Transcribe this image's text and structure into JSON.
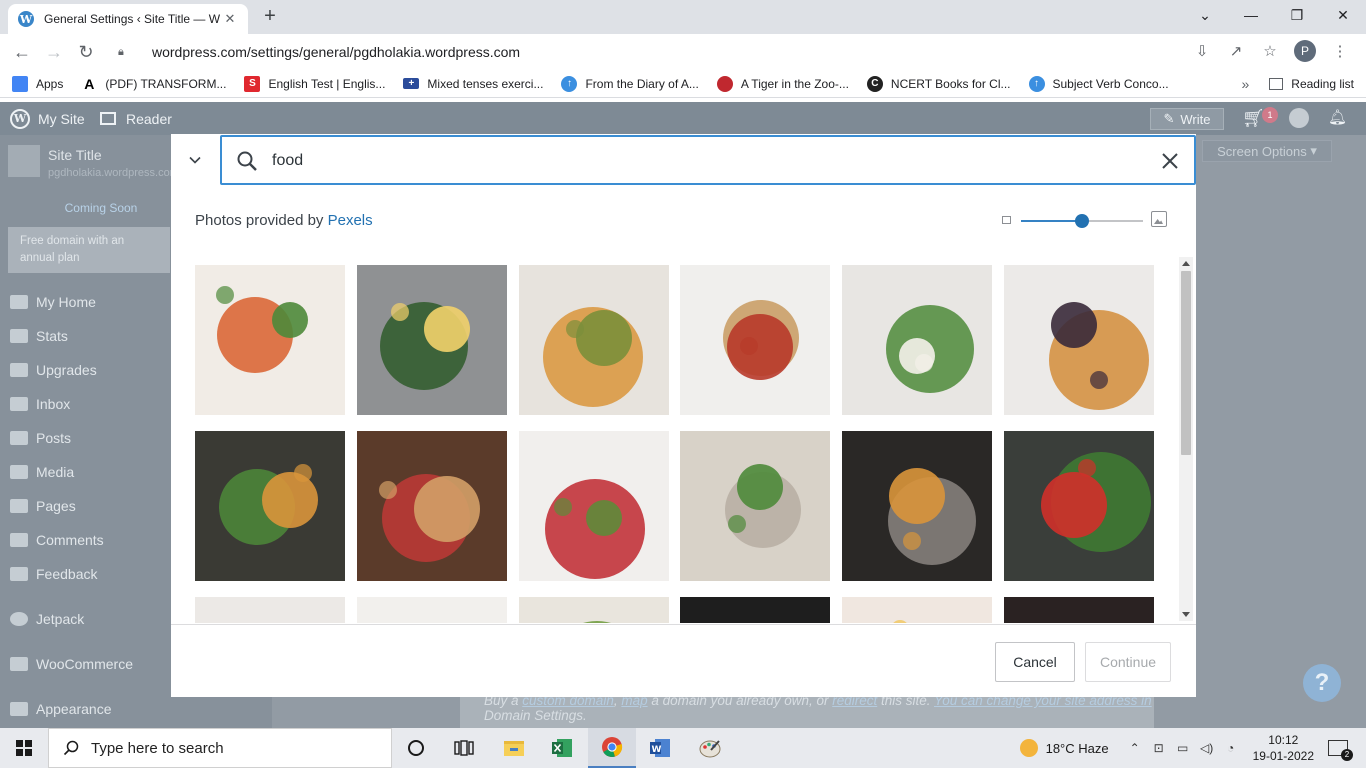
{
  "browser": {
    "tab_title": "General Settings ‹ Site Title — W",
    "url": "wordpress.com/settings/general/pgdholakia.wordpress.com",
    "profile_initial": "P",
    "bookmarks": [
      {
        "label": "Apps",
        "icon": "apps-grid-icon",
        "color": "#4285f4"
      },
      {
        "label": "(PDF) TRANSFORM...",
        "icon": "academia-icon",
        "color": "#000000"
      },
      {
        "label": "English Test | Englis...",
        "icon": "s-logo-icon",
        "color": "#e0282f"
      },
      {
        "label": "Mixed tenses exerci...",
        "icon": "uk-flag-icon",
        "color": "#2b4c9b"
      },
      {
        "label": "From the Diary of A...",
        "icon": "upload-arrow-icon",
        "color": "#3b8fe0"
      },
      {
        "label": "A Tiger in the Zoo-...",
        "icon": "quiz-badge-icon",
        "color": "#c0282f"
      },
      {
        "label": "NCERT Books for Cl...",
        "icon": "ncert-icon",
        "color": "#222222"
      },
      {
        "label": "Subject Verb Conco...",
        "icon": "upload-arrow-icon",
        "color": "#3b8fe0"
      }
    ],
    "reading_list": "Reading list"
  },
  "wp": {
    "my_site": "My Site",
    "reader": "Reader",
    "write": "Write",
    "cart_count": "1",
    "site_title": "Site Title",
    "site_url": "pgdholakia.wordpress.com",
    "coming_soon": "Coming Soon",
    "domain_promo": "Free domain with an annual plan",
    "menu": [
      {
        "label": "My Home",
        "icon": "house-icon"
      },
      {
        "label": "Stats",
        "icon": "stats-icon"
      },
      {
        "label": "Upgrades",
        "icon": "cart-icon"
      },
      {
        "label": "Inbox",
        "icon": "mail-icon"
      },
      {
        "label": "Posts",
        "icon": "pin-icon"
      },
      {
        "label": "Media",
        "icon": "media-icon"
      },
      {
        "label": "Pages",
        "icon": "page-icon"
      },
      {
        "label": "Comments",
        "icon": "comment-icon"
      },
      {
        "label": "Feedback",
        "icon": "feedback-icon"
      },
      {
        "label": "Jetpack",
        "icon": "jetpack-icon"
      },
      {
        "label": "WooCommerce",
        "icon": "woo-icon"
      },
      {
        "label": "Appearance",
        "icon": "brush-icon"
      }
    ],
    "screen_options": "Screen Options",
    "domain_note": {
      "prefix": "Buy a ",
      "custom_domain": "custom domain",
      "sep1": ", ",
      "map": "map",
      "middle": " a domain you already own, or ",
      "redirect": "redirect",
      "suffix": " this site. ",
      "change_link": "You can change your site address in",
      "line2": "Domain Settings."
    }
  },
  "modal": {
    "search_value": "food",
    "provider_prefix": "Photos provided by ",
    "provider_name": "Pexels",
    "zoom_level": 0.5,
    "scroll_position": 0.0,
    "cancel": "Cancel",
    "continue": "Continue",
    "photos": [
      {
        "name": "salad-bowl-tomatoes",
        "bg": "#f1ece6",
        "accent": "#d9602d",
        "accent2": "#4e8a3a"
      },
      {
        "name": "avocado-toast-egg",
        "bg": "#8f9193",
        "accent": "#2f5a2a",
        "accent2": "#f2d16b"
      },
      {
        "name": "pizza-slices",
        "bg": "#e7e3dd",
        "accent": "#d9953b",
        "accent2": "#7b8f3a"
      },
      {
        "name": "spaghetti-fork",
        "bg": "#f0efed",
        "accent": "#c89a5f",
        "accent2": "#b83a2a"
      },
      {
        "name": "plated-greens",
        "bg": "#e8e6e3",
        "accent": "#4e8a3a",
        "accent2": "#f4f1ea"
      },
      {
        "name": "pancake-stack",
        "bg": "#eceae8",
        "accent": "#d48d3a",
        "accent2": "#3a2a3a"
      },
      {
        "name": "bowl-salad-dark",
        "bg": "#3a3a34",
        "accent": "#4e8a3a",
        "accent2": "#d9953b"
      },
      {
        "name": "wooden-board",
        "bg": "#5b3b2a",
        "accent": "#c03a36",
        "accent2": "#d3a067"
      },
      {
        "name": "marble-spices",
        "bg": "#f1efed",
        "accent": "#c0282f",
        "accent2": "#5e8a3a"
      },
      {
        "name": "wood-texture",
        "bg": "#d8d2c8",
        "accent": "#b7aea2",
        "accent2": "#4e8a3a"
      },
      {
        "name": "mortar-vegetables",
        "bg": "#2a2826",
        "accent": "#8a8480",
        "accent2": "#d9953b"
      },
      {
        "name": "basil-tomatoes",
        "bg": "#3a3e3a",
        "accent": "#3f7d33",
        "accent2": "#d0302a"
      },
      {
        "name": "plate-white",
        "bg": "#ece9e6",
        "accent": "#d8d4cf",
        "accent2": "#bdb7b0"
      },
      {
        "name": "knife-herbs",
        "bg": "#f2f0ed",
        "accent": "#7a2a3a",
        "accent2": "#4e8a3a"
      },
      {
        "name": "veg-spread",
        "bg": "#e9e5dd",
        "accent": "#6c9a3a",
        "accent2": "#f1c24b"
      },
      {
        "name": "dark-top",
        "bg": "#1e1e1e",
        "accent": "#c9c7c2",
        "accent2": "#7a7670"
      },
      {
        "name": "colorful-bowls",
        "bg": "#f0e7e0",
        "accent": "#e55a6a",
        "accent2": "#f1c24b"
      },
      {
        "name": "pink-food",
        "bg": "#2a2222",
        "accent": "#d66a86",
        "accent2": "#f0d0d8"
      }
    ]
  },
  "taskbar": {
    "search_placeholder": "Type here to search",
    "apps": [
      "cortana-circle-icon",
      "task-view-icon",
      "file-explorer-icon",
      "excel-icon",
      "chrome-icon",
      "word-icon",
      "paint-icon"
    ],
    "weather": "18°C  Haze",
    "time": "10:12",
    "date": "19-01-2022",
    "notifications": "2"
  }
}
